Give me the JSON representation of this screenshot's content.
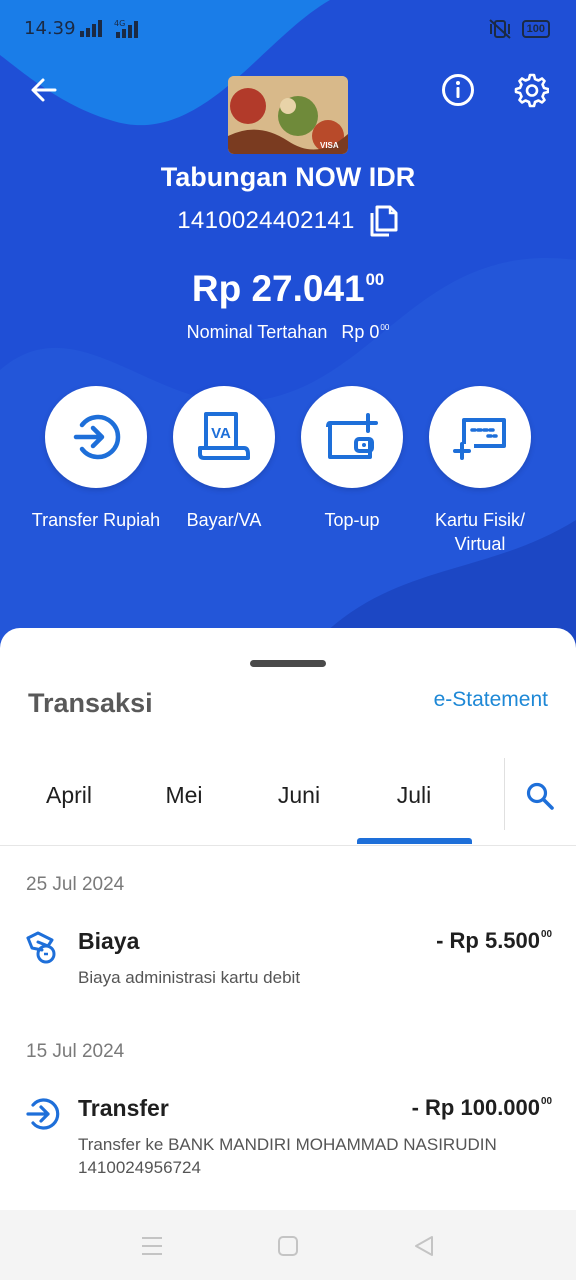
{
  "status_bar": {
    "time": "14.39",
    "network": "4G",
    "battery": "100",
    "icons": [
      "signal-icon",
      "signal-4g-icon",
      "vibrate-icon",
      "battery-icon"
    ]
  },
  "header": {
    "back_icon": "arrow-left-icon",
    "info_icon": "info-icon",
    "settings_icon": "gear-icon"
  },
  "account": {
    "name": "Tabungan NOW IDR",
    "number": "1410024402141",
    "copy_icon": "copy-icon",
    "balance": "Rp 27.041",
    "balance_decimal": "00",
    "held_label": "Nominal Tertahan",
    "held_amount": "Rp 0",
    "held_decimal": "00"
  },
  "actions": [
    {
      "label": "Transfer Rupiah",
      "icon": "transfer-icon"
    },
    {
      "label": "Bayar/VA",
      "icon": "va-icon"
    },
    {
      "label": "Top-up",
      "icon": "wallet-topup-icon"
    },
    {
      "label": "Kartu Fisik/ Virtual",
      "icon": "card-add-icon"
    }
  ],
  "transactions": {
    "title": "Transaksi",
    "estatement_label": "e-Statement",
    "tabs": [
      "April",
      "Mei",
      "Juni",
      "Juli"
    ],
    "active_tab": "Juli",
    "groups": [
      {
        "date": "25 Jul 2024",
        "items": [
          {
            "icon": "fee-icon",
            "name": "Biaya",
            "amount": "- Rp 5.500",
            "amount_decimal": "00",
            "desc": "Biaya administrasi kartu debit"
          }
        ]
      },
      {
        "date": "15 Jul 2024",
        "items": [
          {
            "icon": "transfer-icon",
            "name": "Transfer",
            "amount": "- Rp 100.000",
            "amount_decimal": "00",
            "desc": "Transfer ke BANK MANDIRI MOHAMMAD NASIRUDIN 1410024956724"
          }
        ]
      }
    ]
  },
  "colors": {
    "primary": "#1f4fd6",
    "accent": "#1e88d6",
    "text": "#1f1f1f"
  }
}
